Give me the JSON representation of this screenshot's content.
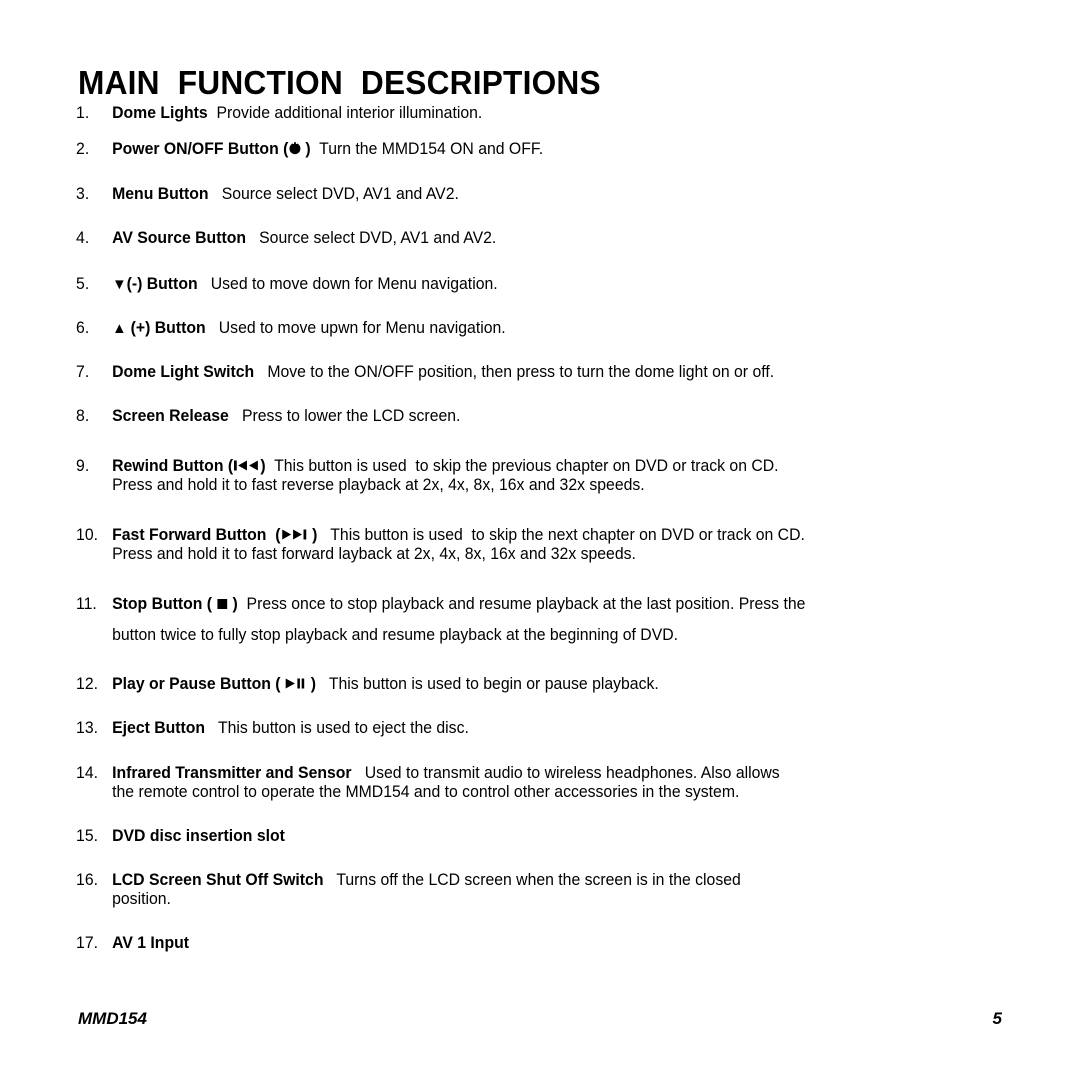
{
  "document": {
    "title": "MAIN  FUNCTION  DESCRIPTIONS",
    "footer": {
      "model": "MMD154",
      "page_number": "5"
    }
  },
  "items": [
    {
      "num": "1.",
      "label": "Dome Lights",
      "desc": "  Provide additional interior illumination.",
      "icon": "none"
    },
    {
      "num": "2.",
      "label": "Power ON/OFF Button (",
      "label_after": " )",
      "desc": "  Turn the MMD154 ON and OFF.",
      "icon": "power-icon"
    },
    {
      "num": "3.",
      "label": "Menu Button",
      "desc": "   Source select DVD, AV1 and AV2.",
      "icon": "none"
    },
    {
      "num": "4.",
      "label": "AV Source Button",
      "desc": "   Source select DVD, AV1 and AV2.",
      "icon": "none"
    },
    {
      "num": "5.",
      "label_pre": "▼",
      "label": "(-) Button",
      "desc": "   Used to move down for Menu navigation.",
      "icon": "triangle-down-icon"
    },
    {
      "num": "6.",
      "label_pre": "▲ ",
      "label": "(+) Button",
      "desc": "   Used to move upwn for Menu navigation.",
      "icon": "triangle-up-icon"
    },
    {
      "num": "7.",
      "label": "Dome Light Switch",
      "desc": "   Move to the ON/OFF position, then press to turn the dome light on or off.",
      "icon": "none"
    },
    {
      "num": "8.",
      "label": "Screen Release",
      "desc": "   Press to lower the LCD screen.",
      "icon": "none"
    },
    {
      "num": "9.",
      "label": "Rewind Button ",
      "label_paren_open": "(",
      "label_paren_close": ")",
      "desc": "  This button is used  to skip the previous chapter on DVD or track on CD.",
      "continuation": "Press and hold it to fast reverse playback at 2x, 4x, 8x, 16x and 32x speeds.",
      "icon": "rewind-icon"
    },
    {
      "num": "10.",
      "label": "Fast Forward Button  ",
      "label_paren_open": "(",
      "label_paren_close": " )",
      "desc": "   This button is used  to skip the next chapter on DVD or track on CD.",
      "continuation": "Press and hold it to fast forward  layback at 2x, 4x, 8x, 16x and 32x speeds.",
      "icon": "fast-forward-icon"
    },
    {
      "num": "11.",
      "label": "Stop Button ( ",
      "label_after": " )",
      "desc": "  Press once to stop playback and resume playback at the last position. Press the",
      "continuation": "button twice to fully stop playback and resume playback at the beginning of DVD.",
      "icon": "stop-icon"
    },
    {
      "num": "12.",
      "label": "Play or Pause Button ( ",
      "label_after": " )",
      "desc": "   This button is used to begin or pause playback.",
      "icon": "play-pause-icon"
    },
    {
      "num": "13.",
      "label": "Eject Button",
      "desc": "   This button is used to eject the disc.",
      "icon": "none"
    },
    {
      "num": "14.",
      "label": "Infrared Transmitter and Sensor",
      "desc": "   Used to transmit audio to wireless headphones. Also allows",
      "continuation": "the remote control to operate the MMD154 and to control other accessories in the system.",
      "icon": "none"
    },
    {
      "num": "15.",
      "label": "DVD disc insertion slot",
      "desc": "",
      "icon": "none"
    },
    {
      "num": "16.",
      "label": "LCD Screen Shut Off Switch",
      "desc": "   Turns off the LCD screen when the screen is in the closed",
      "continuation": "position.",
      "icon": "none"
    },
    {
      "num": "17.",
      "label": "AV 1 Input",
      "desc": "",
      "icon": "none"
    }
  ],
  "colors": {
    "background": "#ffffff",
    "text": "#000000"
  }
}
